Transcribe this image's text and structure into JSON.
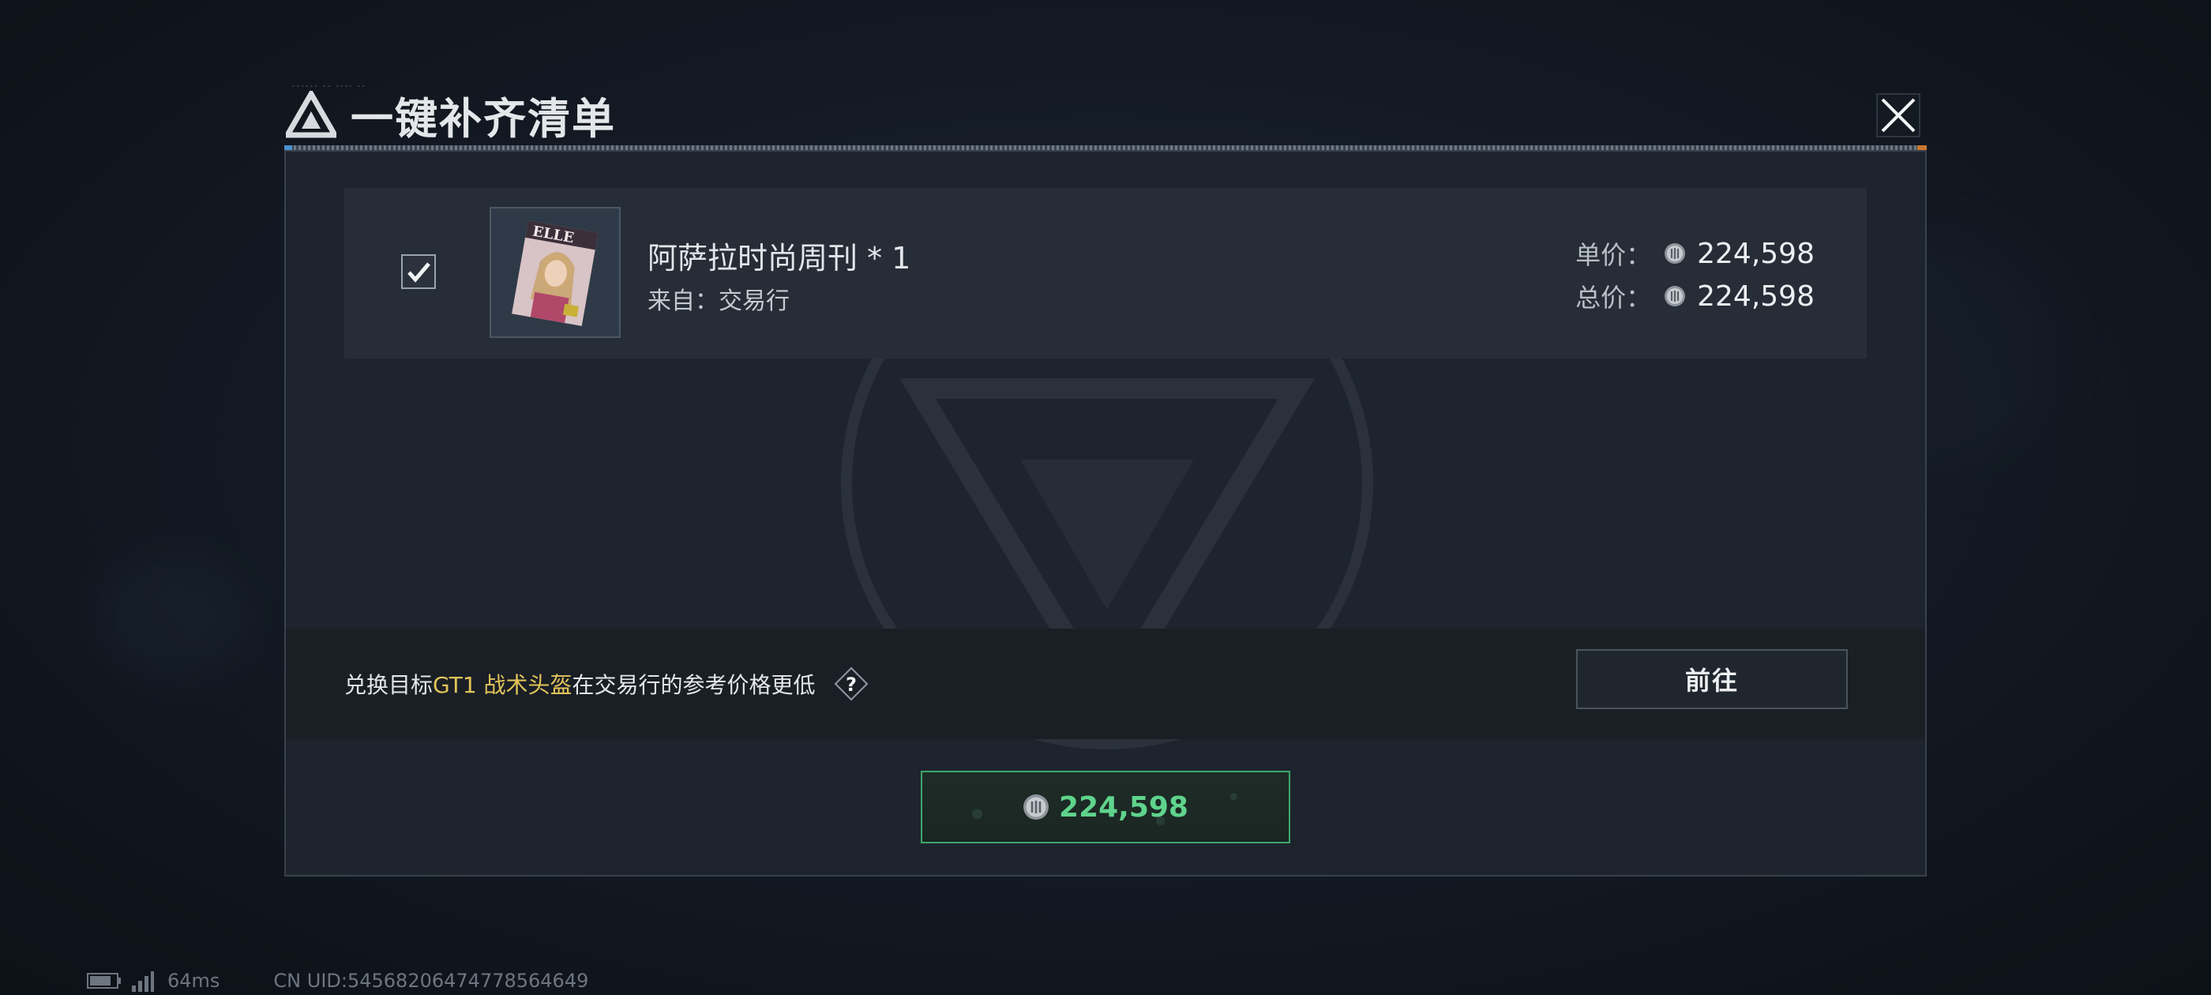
{
  "dialog": {
    "title": "一键补齐清单",
    "title_deco": "------ -- ---- --"
  },
  "item": {
    "checked": true,
    "name": "阿萨拉时尚周刊 * 1",
    "source": "来自：交易行",
    "unit_price_label": "单价：",
    "unit_price": "224,598",
    "total_price_label": "总价：",
    "total_price": "224,598",
    "thumbnail_icon": "magazine-cover-icon"
  },
  "info": {
    "prefix": "兑换目标",
    "target": "GT1 战术头盔",
    "suffix": "在交易行的参考价格更低",
    "help_label": "?",
    "goto_label": "前往"
  },
  "pay": {
    "amount": "224,598"
  },
  "status": {
    "ping": "64ms",
    "uid": "CN UID:54568206474778564649"
  },
  "colors": {
    "highlight": "#e2c45a",
    "pay_green": "#5fd38c",
    "pay_border": "#3fa66b"
  }
}
